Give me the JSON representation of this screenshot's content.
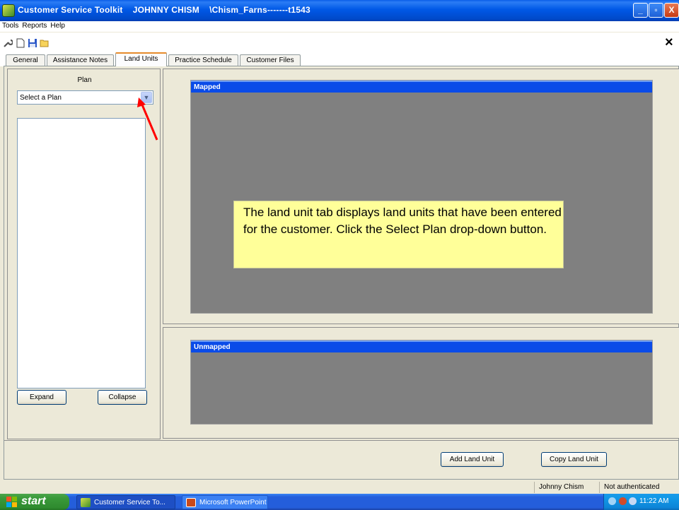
{
  "window": {
    "title": "Customer Service Toolkit    JOHNNY CHISM    \\Chism_Farns-------t1543",
    "minimize_label": "_",
    "maximize_label": "▫",
    "close_label": "X"
  },
  "menu": {
    "items": [
      "Tools",
      "Reports",
      "Help"
    ]
  },
  "toolbar": {
    "icons": [
      "wrench-icon",
      "new-document-icon",
      "save-icon",
      "open-folder-icon"
    ],
    "close_label": "×"
  },
  "tabs": [
    {
      "label": "General"
    },
    {
      "label": "Assistance Notes"
    },
    {
      "label": "Land Units",
      "active": true
    },
    {
      "label": "Practice Schedule"
    },
    {
      "label": "Customer Files"
    }
  ],
  "plan": {
    "label": "Plan",
    "select_value": "Select a Plan",
    "expand_label": "Expand",
    "collapse_label": "Collapse"
  },
  "mapped": {
    "header": "Mapped"
  },
  "unmapped": {
    "header": "Unmapped"
  },
  "callout": {
    "text": "The land unit tab displays land units that have been entered for the customer. Click the Select Plan drop-down button."
  },
  "actions": {
    "add_label": "Add Land Unit",
    "copy_label": "Copy Land Unit"
  },
  "status": {
    "user": "Johnny Chism",
    "auth": "Not authenticated"
  },
  "taskbar": {
    "start_label": "start",
    "tasks": [
      "Customer Service To...",
      "Microsoft PowerPoint ..."
    ],
    "clock": "11:22 AM"
  },
  "colors": {
    "title_blue": "#0058e6",
    "grid_header": "#0a4be8",
    "grid_body": "#808080",
    "callout_bg": "#ffff99",
    "arrow": "#ff0000"
  }
}
